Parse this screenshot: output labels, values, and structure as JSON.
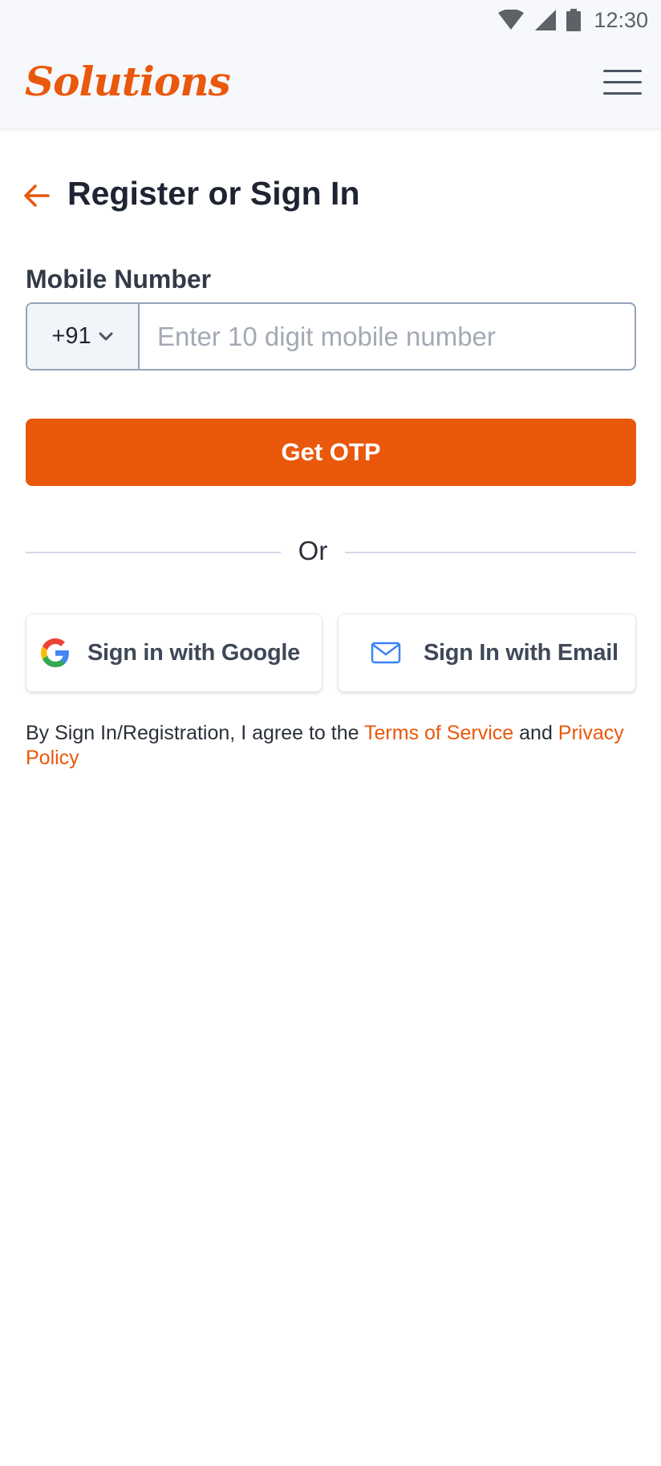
{
  "status_bar": {
    "time": "12:30",
    "icons": [
      "wifi-icon",
      "cellular-signal-icon",
      "battery-icon"
    ]
  },
  "header": {
    "logo_text": "Solutions",
    "menu_icon": "hamburger-menu-icon"
  },
  "page": {
    "back_icon": "arrow-left-icon",
    "title": "Register or Sign In"
  },
  "form": {
    "mobile_label": "Mobile Number",
    "country_code": "+91",
    "phone_value": "",
    "phone_placeholder": "Enter 10 digit mobile number",
    "submit_label": "Get OTP"
  },
  "divider": {
    "text": "Or"
  },
  "social": {
    "google_label": "Sign in with Google",
    "email_label": "Sign In with Email"
  },
  "terms": {
    "prefix": "By Sign In/Registration, I agree to the ",
    "terms_link": "Terms of Service",
    "middle": " and ",
    "privacy_link": "Privacy Policy"
  },
  "colors": {
    "accent": "#ea580c",
    "header_bg": "#f6f8fb",
    "text_primary": "#1f2433",
    "placeholder": "#a3aab5",
    "border": "#94a3b8"
  }
}
